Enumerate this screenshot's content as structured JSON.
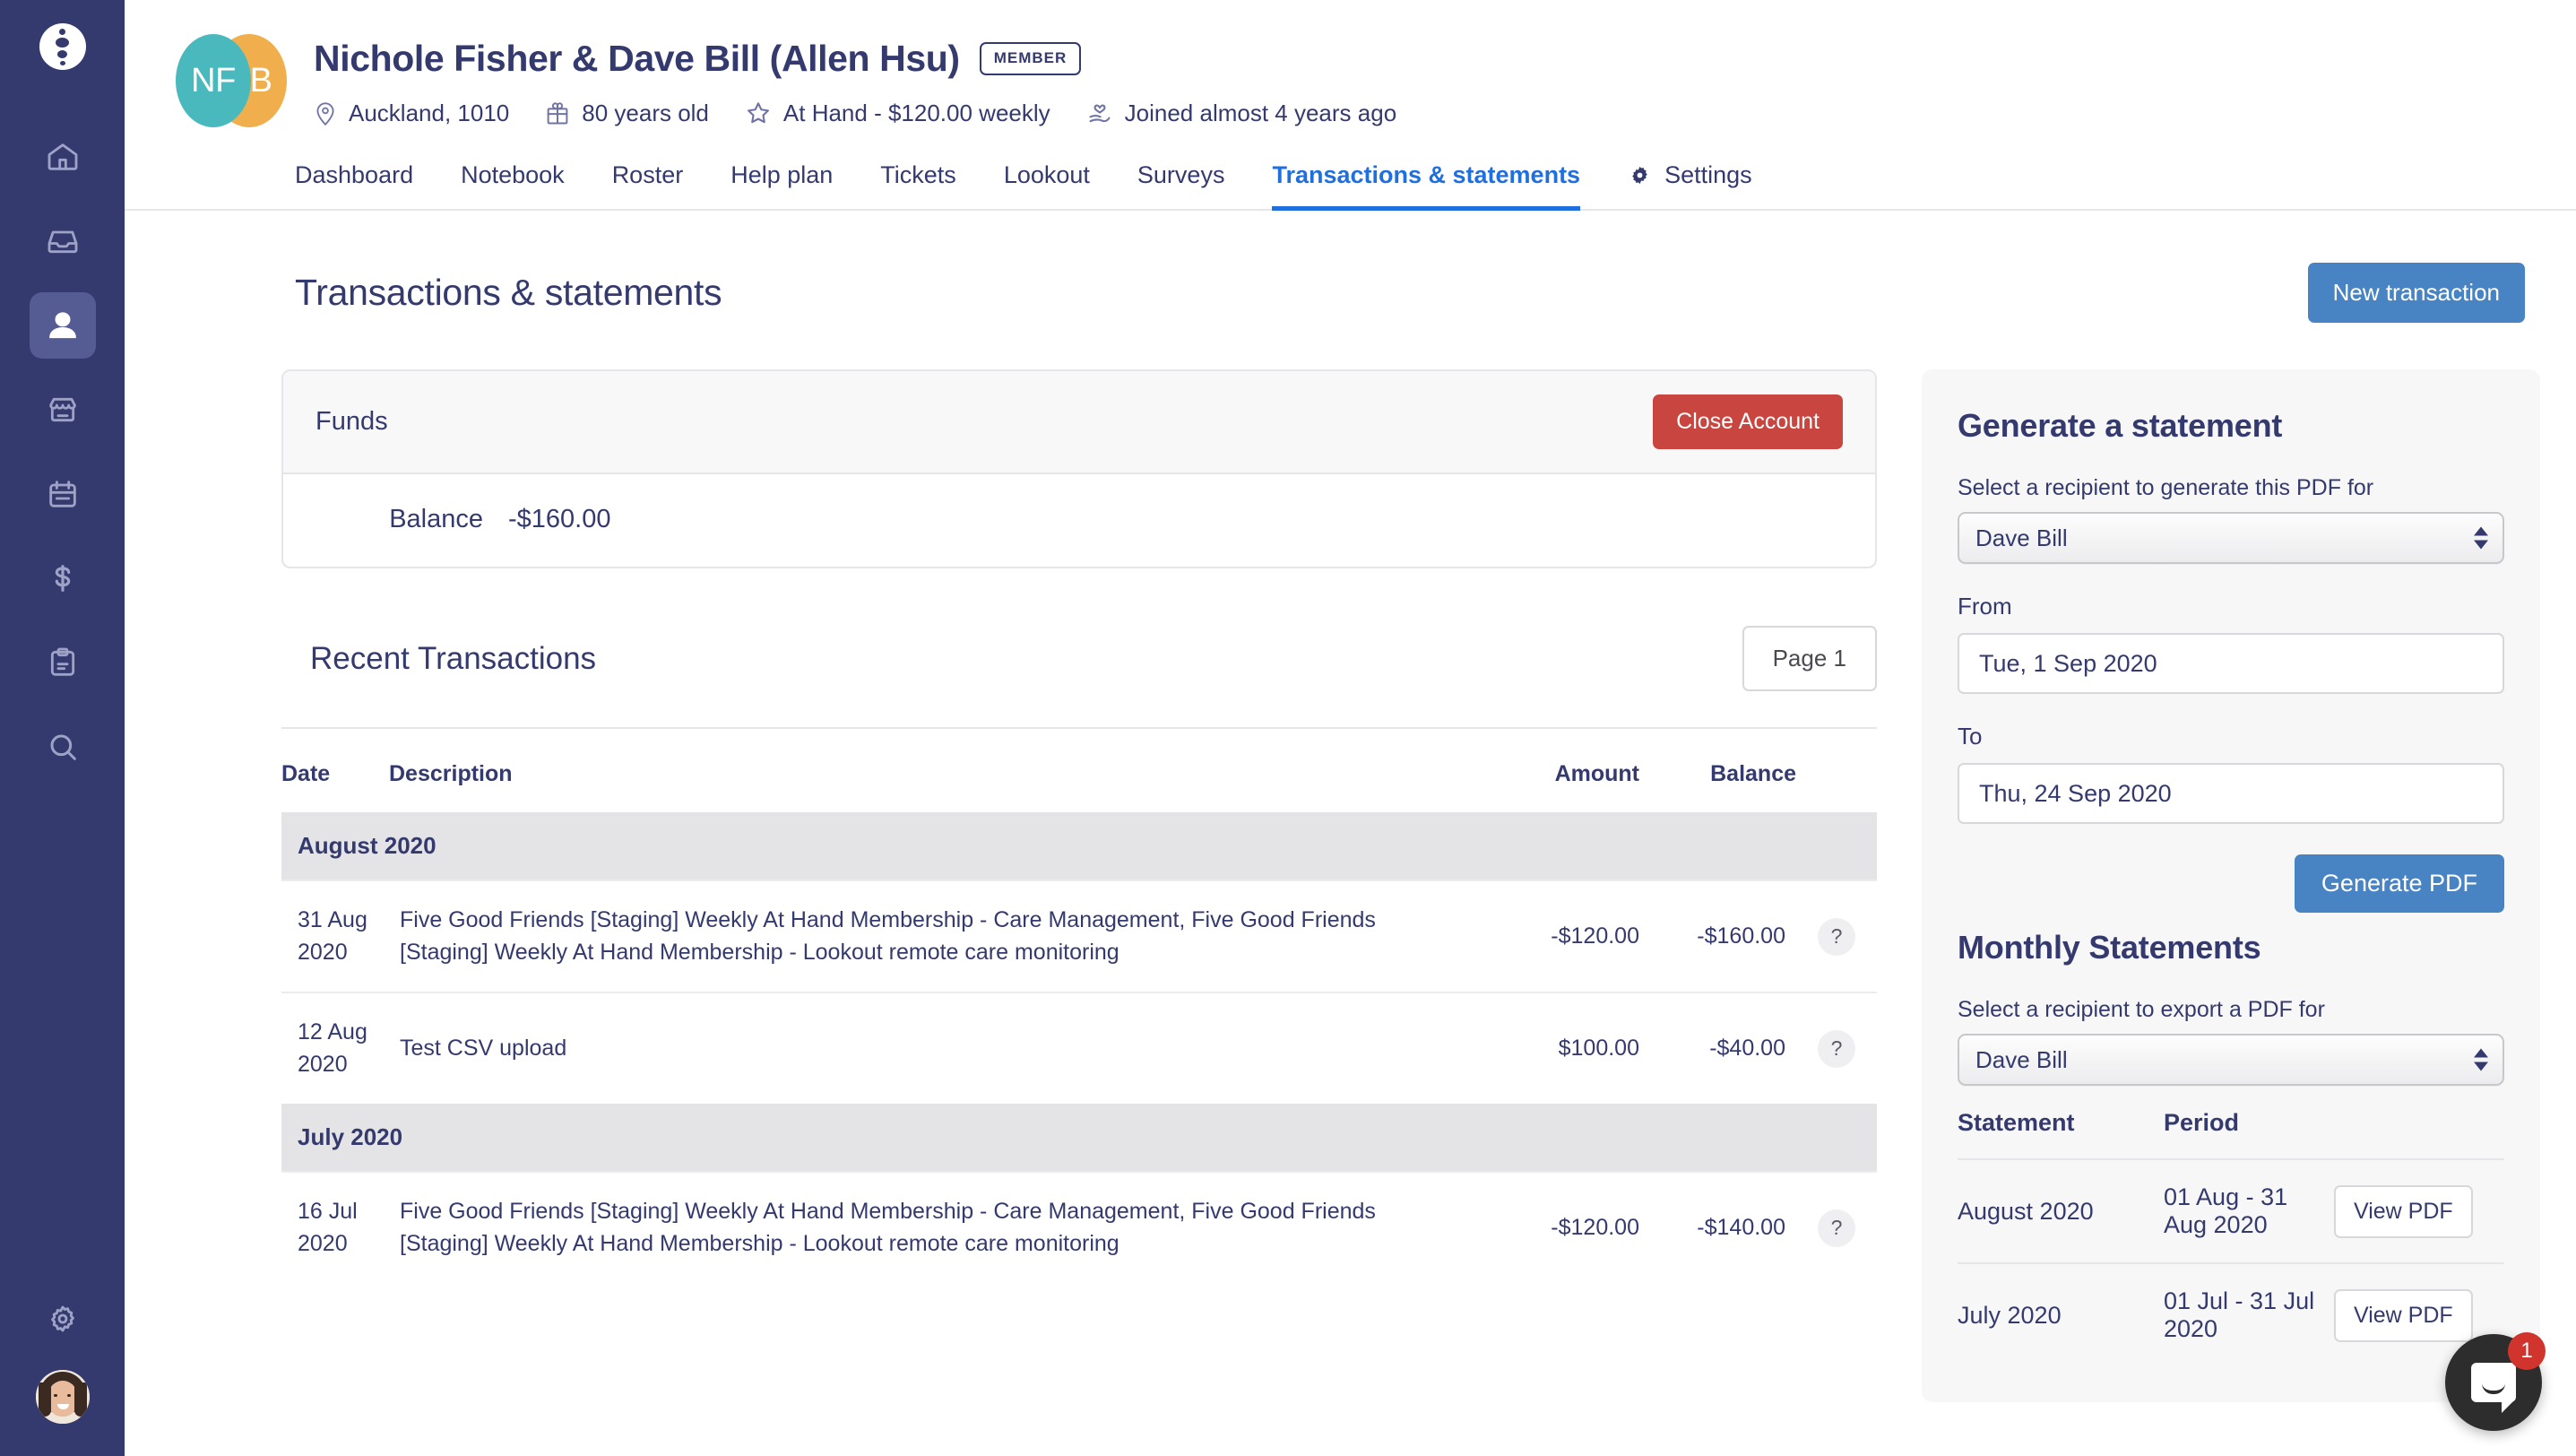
{
  "sidebar": {
    "logo_name": "app-logo",
    "items": [
      {
        "icon": "home-icon",
        "active": false
      },
      {
        "icon": "inbox-icon",
        "active": false
      },
      {
        "icon": "person-icon",
        "active": true
      },
      {
        "icon": "store-icon",
        "active": false
      },
      {
        "icon": "calendar-icon",
        "active": false
      },
      {
        "icon": "dollar-icon",
        "active": false
      },
      {
        "icon": "clipboard-icon",
        "active": false
      },
      {
        "icon": "search-icon",
        "active": false
      },
      {
        "icon": "gear-icon",
        "active": false
      }
    ]
  },
  "profile": {
    "avatar_left_initials": "NF",
    "avatar_right_initials": "B",
    "name": "Nichole Fisher & Dave Bill (Allen Hsu)",
    "badge": "MEMBER",
    "meta": [
      {
        "icon": "location-pin-icon",
        "text": "Auckland, 1010"
      },
      {
        "icon": "gift-icon",
        "text": "80 years old"
      },
      {
        "icon": "star-icon",
        "text": "At Hand - $120.00 weekly"
      },
      {
        "icon": "heart-hand-icon",
        "text": "Joined almost 4 years ago"
      }
    ]
  },
  "tabs": [
    {
      "label": "Dashboard",
      "active": false
    },
    {
      "label": "Notebook",
      "active": false
    },
    {
      "label": "Roster",
      "active": false
    },
    {
      "label": "Help plan",
      "active": false
    },
    {
      "label": "Tickets",
      "active": false
    },
    {
      "label": "Lookout",
      "active": false
    },
    {
      "label": "Surveys",
      "active": false
    },
    {
      "label": "Transactions & statements",
      "active": true
    },
    {
      "label": "Settings",
      "active": false,
      "icon": "gear-icon"
    }
  ],
  "page": {
    "title": "Transactions & statements",
    "new_transaction_label": "New transaction"
  },
  "funds": {
    "title": "Funds",
    "close_account_label": "Close Account",
    "balance_label": "Balance",
    "balance_value": "-$160.00"
  },
  "recent": {
    "title": "Recent Transactions",
    "page_label": "Page 1",
    "columns": {
      "date": "Date",
      "description": "Description",
      "amount": "Amount",
      "balance": "Balance"
    },
    "help_label": "?",
    "groups": [
      {
        "month": "August 2020",
        "rows": [
          {
            "date": "31 Aug 2020",
            "description": "Five Good Friends [Staging] Weekly At Hand Membership - Care Management, Five Good Friends [Staging] Weekly At Hand Membership - Lookout remote care monitoring",
            "amount": "-$120.00",
            "amount_sign": "negative",
            "balance": "-$160.00"
          },
          {
            "date": "12 Aug 2020",
            "description": "Test CSV upload",
            "amount": "$100.00",
            "amount_sign": "positive",
            "balance": "-$40.00"
          }
        ]
      },
      {
        "month": "July 2020",
        "rows": [
          {
            "date": "16 Jul 2020",
            "description": "Five Good Friends [Staging] Weekly At Hand Membership - Care Management, Five Good Friends [Staging] Weekly At Hand Membership - Lookout remote care monitoring",
            "amount": "-$120.00",
            "amount_sign": "negative",
            "balance": "-$140.00"
          }
        ]
      }
    ]
  },
  "generate_statement": {
    "title": "Generate a statement",
    "recipient_label": "Select a recipient to generate this PDF for",
    "recipient_value": "Dave Bill",
    "from_label": "From",
    "from_value": "Tue, 1 Sep 2020",
    "to_label": "To",
    "to_value": "Thu, 24 Sep 2020",
    "generate_button": "Generate PDF"
  },
  "monthly_statements": {
    "title": "Monthly Statements",
    "recipient_label": "Select a recipient to export a PDF for",
    "recipient_value": "Dave Bill",
    "columns": {
      "statement": "Statement",
      "period": "Period"
    },
    "view_label": "View PDF",
    "rows": [
      {
        "statement": "August 2020",
        "period": "01 Aug - 31 Aug 2020"
      },
      {
        "statement": "July 2020",
        "period": "01 Jul - 31 Jul 2020"
      }
    ]
  },
  "intercom": {
    "badge_count": "1"
  },
  "colors": {
    "sidebar": "#343A6E",
    "brand_navy": "#343A6E",
    "accent_blue": "#1F6FDE",
    "button_blue": "#4884C4",
    "danger_red": "#C9453F",
    "positive_green": "#26A745",
    "avatar_teal": "#49B9BE",
    "avatar_orange": "#F0AF4C"
  }
}
